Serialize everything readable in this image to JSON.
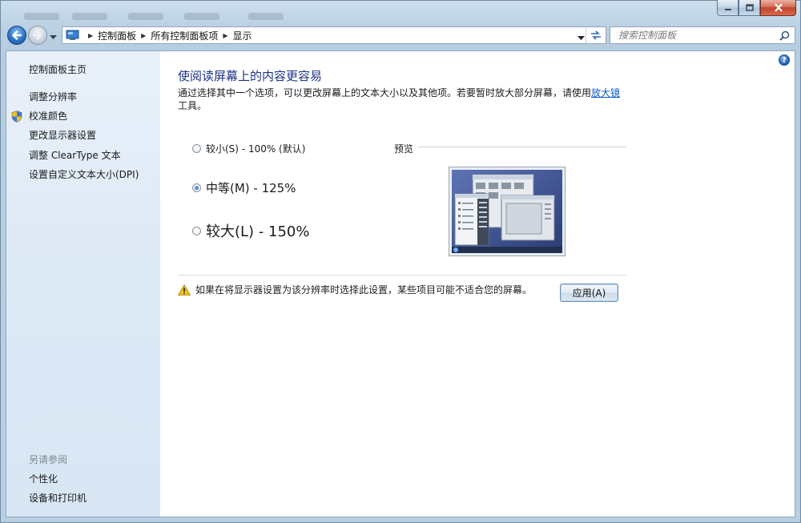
{
  "window": {
    "caption_buttons": [
      "minimize",
      "maximize",
      "close"
    ]
  },
  "navbar": {
    "breadcrumbs": [
      "控制面板",
      "所有控制面板项",
      "显示"
    ],
    "search_placeholder": "搜索控制面板"
  },
  "sidebar": {
    "items": [
      {
        "label": "控制面板主页"
      },
      {
        "label": "调整分辨率"
      },
      {
        "label": "校准颜色",
        "icon": "uac-shield-icon"
      },
      {
        "label": "更改显示器设置"
      },
      {
        "label": "调整 ClearType 文本"
      },
      {
        "label": "设置自定义文本大小(DPI)"
      }
    ],
    "see_also_heading": "另请参阅",
    "see_also": [
      {
        "label": "个性化"
      },
      {
        "label": "设备和打印机"
      }
    ]
  },
  "main": {
    "title": "使阅读屏幕上的内容更容易",
    "description_before_link": "通过选择其中一个选项，可以更改屏幕上的文本大小以及其他项。若要暂时放大部分屏幕，请使用",
    "description_link": "放大镜",
    "description_after_link": "工具。",
    "options": [
      {
        "label": "较小(S) - 100% (默认)",
        "selected": false
      },
      {
        "label": "中等(M) - 125%",
        "selected": true
      },
      {
        "label": "较大(L) - 150%",
        "selected": false
      }
    ],
    "preview_label": "预览",
    "warning_text": "如果在将显示器设置为该分辨率时选择此设置，某些项目可能不适合您的屏幕。",
    "apply_label": "应用(A)"
  },
  "colors": {
    "title_blue": "#1e3287",
    "link_blue": "#0b5bc4",
    "sidebar_bg": "#dfeaf6",
    "preview_desktop": "#3b4f8e"
  }
}
